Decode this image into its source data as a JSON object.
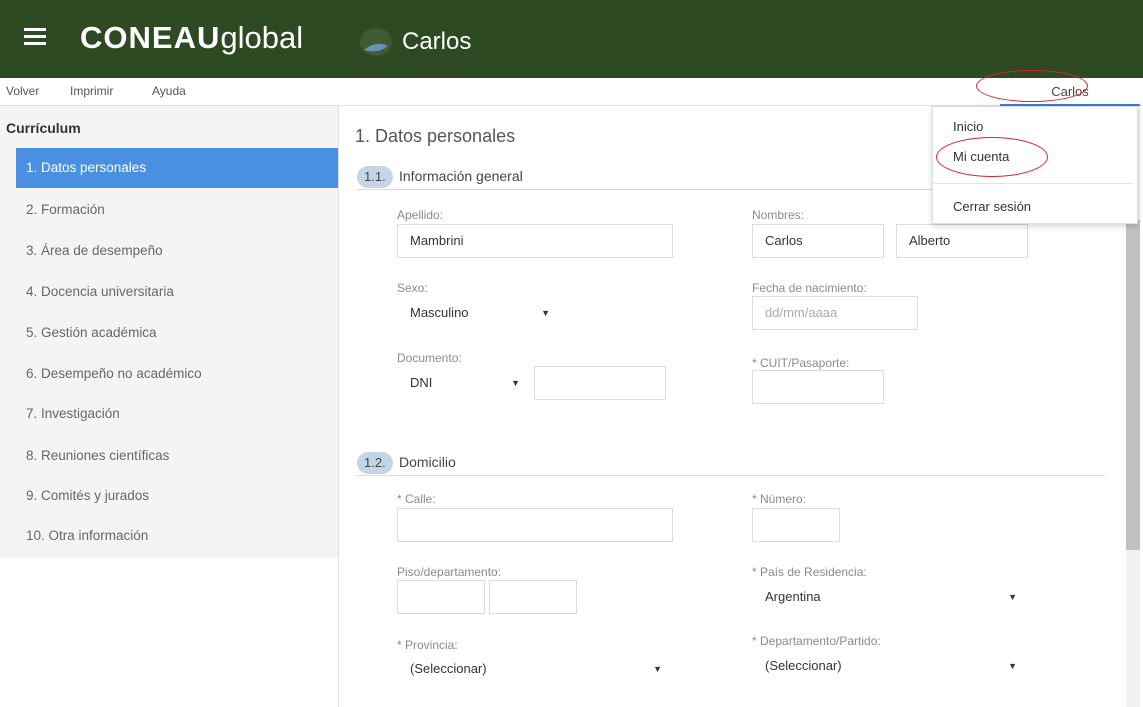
{
  "header": {
    "brand_strong": "CONEAU",
    "brand_light": "global",
    "user_name": "Carlos"
  },
  "menubar": {
    "back": "Volver",
    "print": "Imprimir",
    "help": "Ayuda",
    "user": "Carlos"
  },
  "user_dropdown": {
    "items": [
      "Inicio",
      "Mi cuenta",
      "Cerrar sesión"
    ]
  },
  "sidebar": {
    "title": "Currículum",
    "items": [
      "1. Datos personales",
      "2. Formación",
      "3. Área de desempeño",
      "4. Docencia universitaria",
      "5. Gestión académica",
      "6. Desempeño no académico",
      "7. Investigación",
      "8. Reuniones científicas",
      "9. Comités y jurados",
      "10. Otra información"
    ]
  },
  "main": {
    "page_title": "1. Datos personales",
    "section1": {
      "num": "1.1.",
      "title": "Información general"
    },
    "section2": {
      "num": "1.2.",
      "title": "Domicilio"
    },
    "fields": {
      "apellido_label": "Apellido:",
      "apellido_value": "Mambrini",
      "nombres_label": "Nombres:",
      "nombre1_value": "Carlos",
      "nombre2_value": "Alberto",
      "sexo_label": "Sexo:",
      "sexo_value": "Masculino",
      "fecha_label": "Fecha de nacimiento:",
      "fecha_placeholder": "dd/mm/aaaa",
      "documento_label": "Documento:",
      "documento_type": "DNI",
      "cuit_label": "* CUIT/Pasaporte:",
      "calle_label": "* Calle:",
      "numero_label": "* Número:",
      "piso_label": "Piso/departamento:",
      "pais_label": "* País de Residencia:",
      "pais_value": "Argentina",
      "provincia_label": "* Provincia:",
      "provincia_value": "(Seleccionar)",
      "depto_label": "* Departamento/Partido:",
      "depto_value": "(Seleccionar)"
    }
  },
  "colors": {
    "header_bg": "#2d4a22",
    "active_nav": "#4a90e2",
    "annotation_ring": "#d4262a"
  }
}
